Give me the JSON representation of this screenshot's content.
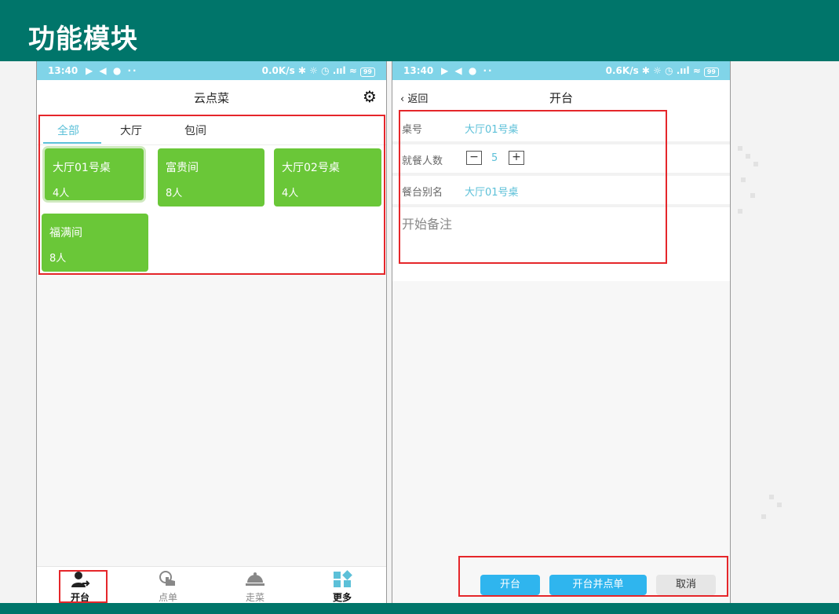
{
  "slide": {
    "title": "功能模块"
  },
  "status_left": {
    "time": "13:40",
    "apps": "▶ ◀ ● ··",
    "right": "0.0K/s ✱ ☼ ◷ .ııl ≈",
    "battery": "99"
  },
  "status_right": {
    "time": "13:40",
    "apps": "▶ ◀ ● ··",
    "right": "0.6K/s ✱ ☼ ◷ .ııl ≈",
    "battery": "99"
  },
  "left_screen": {
    "title": "云点菜",
    "tabs": [
      {
        "label": "全部",
        "active": true
      },
      {
        "label": "大厅"
      },
      {
        "label": "包间"
      }
    ],
    "tables": [
      {
        "name": "大厅01号桌",
        "seats": "4人"
      },
      {
        "name": "富贵间",
        "seats": "8人"
      },
      {
        "name": "大厅02号桌",
        "seats": "4人"
      },
      {
        "name": "福满间",
        "seats": "8人"
      }
    ],
    "nav": [
      {
        "label": "开台",
        "icon": "user-arrow-icon"
      },
      {
        "label": "点单",
        "icon": "hand-pointer-icon"
      },
      {
        "label": "走菜",
        "icon": "serving-dish-icon"
      },
      {
        "label": "更多",
        "icon": "grid-more-icon"
      }
    ]
  },
  "right_screen": {
    "back": "返回",
    "title": "开台",
    "fields": {
      "table_label": "桌号",
      "table_value": "大厅01号桌",
      "guests_label": "就餐人数",
      "guests_value": "5",
      "alias_label": "餐台别名",
      "alias_value": "大厅01号桌",
      "remark_placeholder": "开始备注"
    },
    "actions": {
      "open": "开台",
      "open_order": "开台并点单",
      "cancel": "取消"
    }
  },
  "colors": {
    "header": "#00756a",
    "card": "#6ac738",
    "accent": "#5cc0d8",
    "button": "#2fb5ee",
    "highlight": "#e5262a"
  }
}
